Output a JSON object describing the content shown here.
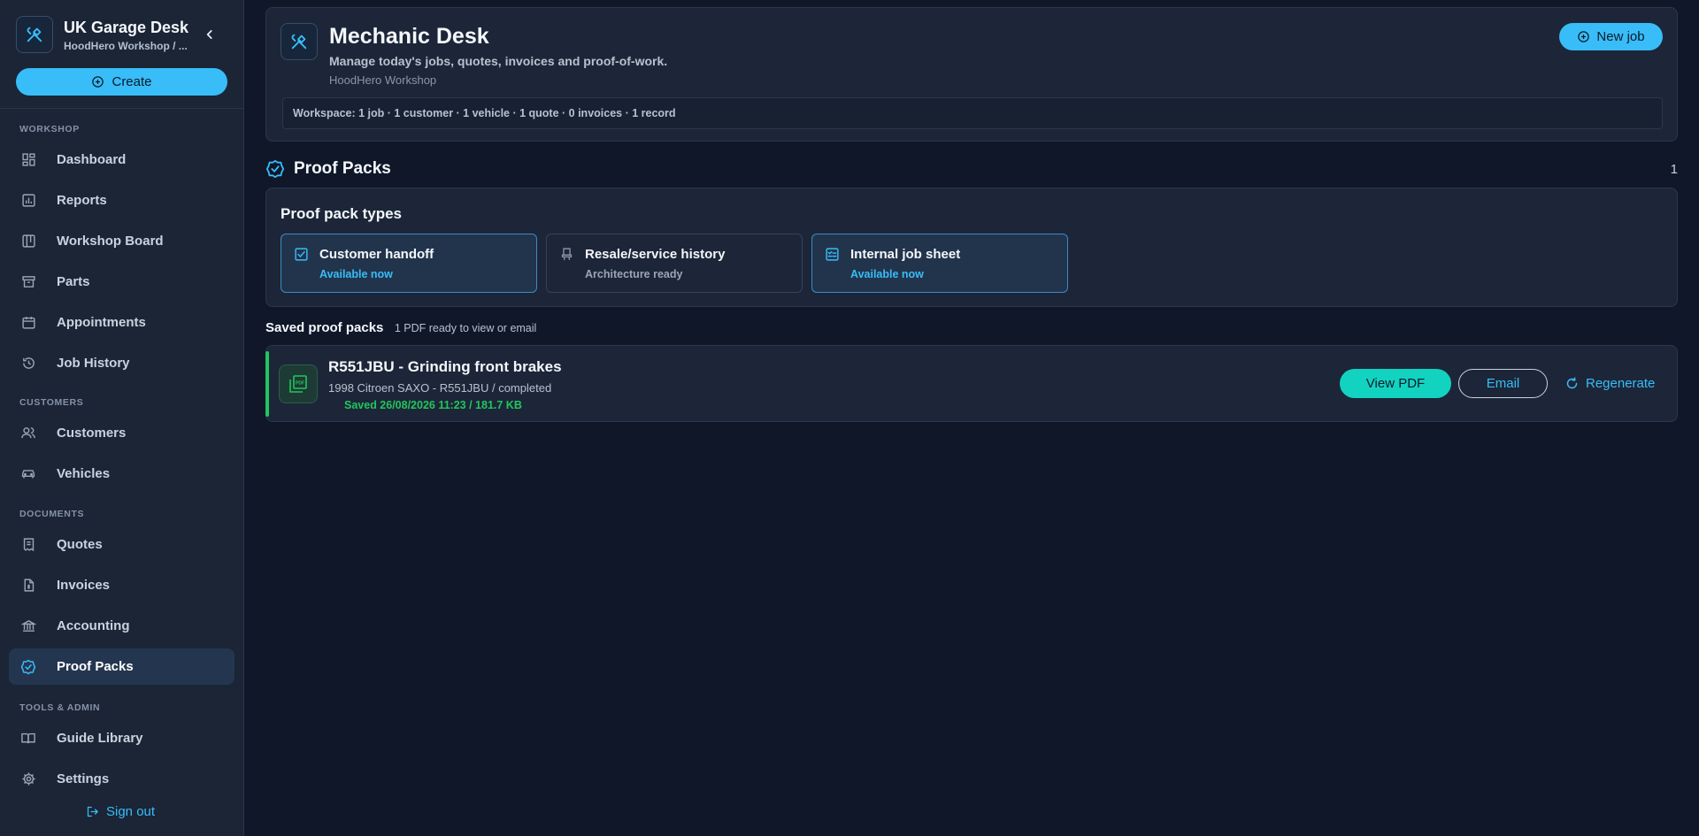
{
  "brand": {
    "title": "UK Garage Desk",
    "subtitle": "HoodHero Workshop / ..."
  },
  "sidebar": {
    "create_label": "Create",
    "sections": {
      "workshop": "WORKSHOP",
      "customers": "CUSTOMERS",
      "documents": "DOCUMENTS",
      "tools": "TOOLS & ADMIN"
    },
    "items": {
      "dashboard": "Dashboard",
      "reports": "Reports",
      "workshop_board": "Workshop Board",
      "parts": "Parts",
      "appointments": "Appointments",
      "job_history": "Job History",
      "customers": "Customers",
      "vehicles": "Vehicles",
      "quotes": "Quotes",
      "invoices": "Invoices",
      "accounting": "Accounting",
      "proof_packs": "Proof Packs",
      "guide_library": "Guide Library",
      "settings": "Settings"
    },
    "active_item": "proof_packs",
    "signout_label": "Sign out"
  },
  "header": {
    "title": "Mechanic Desk",
    "subtitle": "Manage today's jobs, quotes, invoices and proof-of-work.",
    "org": "HoodHero Workshop",
    "new_job_label": "New job",
    "workspace_summary": "Workspace: 1 job · 1 customer · 1 vehicle · 1 quote · 0 invoices · 1 record"
  },
  "proof_packs": {
    "title": "Proof Packs",
    "count": "1",
    "types_title": "Proof pack types",
    "types": [
      {
        "name": "Customer handoff",
        "status": "Available now",
        "icon": "checkbox-icon"
      },
      {
        "name": "Resale/service history",
        "status": "Architecture ready",
        "icon": "car-seat-icon"
      },
      {
        "name": "Internal job sheet",
        "status": "Available now",
        "icon": "checklist-icon"
      }
    ],
    "saved_title": "Saved proof packs",
    "saved_subtitle": "1 PDF ready to view or email",
    "saved": [
      {
        "title": "R551JBU - Grinding front brakes",
        "meta": "1998 Citroen SAXO - R551JBU / completed",
        "saved": "Saved 26/08/2026 11:23 / 181.7 KB",
        "view_label": "View PDF",
        "email_label": "Email",
        "regenerate_label": "Regenerate"
      }
    ]
  },
  "colors": {
    "accent": "#38bdf8",
    "teal": "#12d3c0",
    "success": "#22c55e",
    "background": "#0f1729",
    "surface": "#1c2638"
  }
}
